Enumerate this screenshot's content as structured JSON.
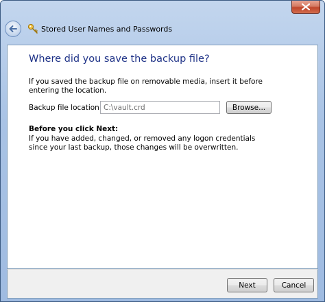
{
  "window": {
    "nav_title": "Stored User Names and Passwords",
    "close_icon": "close-icon",
    "back_icon": "back-arrow-icon",
    "title_icon": "key-icon"
  },
  "page": {
    "heading": "Where did you save the backup file?",
    "intro": "If you saved the backup file on removable media, insert it before entering the location.",
    "location_label": "Backup file location:",
    "location_value": "C:\\vault.crd",
    "browse_label": "Browse...",
    "before_title": "Before you click Next:",
    "before_text": "If you have added, changed, or removed any logon credentials since your last backup, those changes will be overwritten."
  },
  "footer": {
    "next_label": "Next",
    "cancel_label": "Cancel"
  },
  "colors": {
    "heading": "#1e3287",
    "frame": "#a9c3e5",
    "close_button": "#c0462b"
  }
}
